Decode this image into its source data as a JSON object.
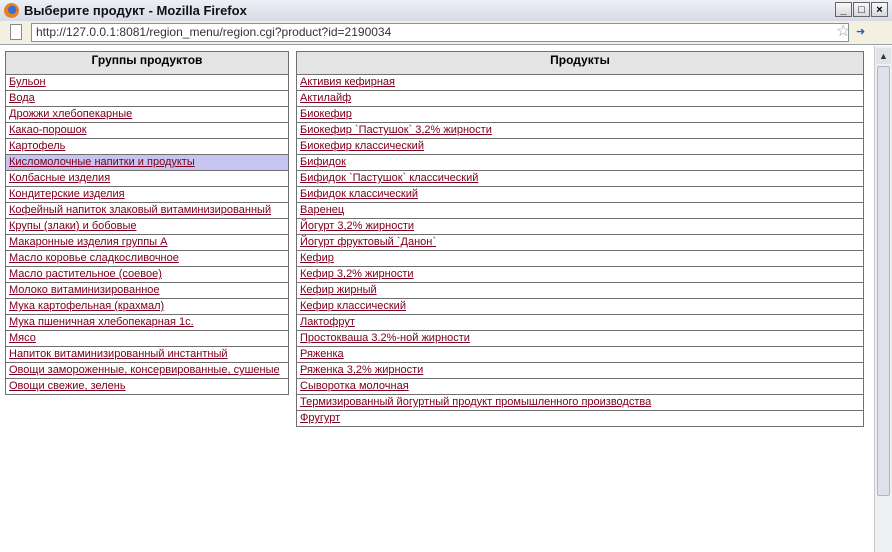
{
  "window": {
    "title": "Выберите продукт - Mozilla Firefox",
    "buttons": [
      "_",
      "□",
      "×"
    ]
  },
  "navbar": {
    "url": "http://127.0.0.1:8081/region_menu/region.cgi?product?id=2190034"
  },
  "groups": {
    "header": "Группы продуктов",
    "items": [
      "Бульон",
      "Вода",
      "Дрожжи хлебопекарные",
      "Какао-порошок",
      "Картофель",
      "Кисломолочные напитки и продукты",
      "Колбасные изделия",
      "Кондитерские изделия",
      "Кофейный напиток злаковый витаминизированный",
      "Крупы (злаки) и бобовые",
      "Макаронные изделия группы А",
      "Масло коровье сладкосливочное",
      "Масло растительное (соевое)",
      "Молоко витаминизированное",
      "Мука картофельная (крахмал)",
      "Мука пшеничная хлебопекарная 1с.",
      "Мясо",
      "Напиток витаминизированный инстантный",
      "Овощи замороженные, консервированные, сушеные",
      "Овощи свежие, зелень"
    ],
    "selected_index": 5
  },
  "products": {
    "header": "Продукты",
    "items": [
      "Активия кефирная",
      "Актилайф",
      "Биокефир",
      "Биокефир `Пастушок` 3,2% жирности",
      "Биокефир классический",
      "Бифидок",
      "Бифидок `Пастушок` классический",
      "Бифидок классический",
      "Варенец",
      "Йогурт 3,2% жирности",
      "Йогурт фруктовый `Данон`",
      "Кефир",
      "Кефир 3,2% жирности",
      "Кефир жирный",
      "Кефир классический",
      "Лактофрут",
      "Простокваша 3.2%-ной жирности",
      "Ряженка",
      "Ряженка 3,2% жирности",
      "Сыворотка молочная",
      "Термизированный йогуртный продукт промышленного производства",
      "Фругурт"
    ]
  }
}
